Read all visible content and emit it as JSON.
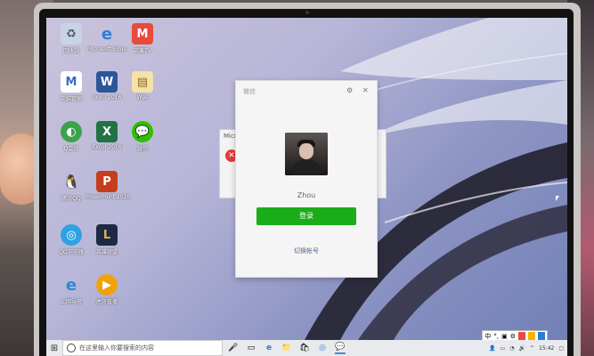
{
  "desktop": {
    "icons": [
      {
        "label": "回收站",
        "icon": "recycle-bin-icon",
        "color": "#c7d4e6"
      },
      {
        "label": "Microsoft Edge",
        "icon": "edge-icon",
        "color": "#2a7fd4"
      },
      {
        "label": "芒果TV",
        "icon": "mango-tv-icon",
        "color": "#e84a3b"
      },
      {
        "label": "电脑管家",
        "icon": "pc-manager-icon",
        "color": "#3b6bc4"
      },
      {
        "label": "Word 2016",
        "icon": "word-icon",
        "color": "#2b579a"
      },
      {
        "label": "Wps",
        "icon": "wps-icon",
        "color": "#d9a441"
      },
      {
        "label": "Q会员",
        "icon": "green-app-icon",
        "color": "#3aa34c"
      },
      {
        "label": "Excel 2016",
        "icon": "excel-icon",
        "color": "#217346"
      },
      {
        "label": "微信",
        "icon": "wechat-icon",
        "color": "#2dc100"
      },
      {
        "label": "腾讯QQ",
        "icon": "qq-icon",
        "color": "#1b1b1b"
      },
      {
        "label": "PowerPoint 2016",
        "icon": "powerpoint-icon",
        "color": "#c43e1c"
      },
      {
        "label": "QQ浏览器",
        "icon": "qq-browser-icon",
        "color": "#2da3e4"
      },
      {
        "label": "英雄联盟",
        "icon": "lol-icon",
        "color": "#1e2a44"
      },
      {
        "label": "上网导航",
        "icon": "ie-icon",
        "color": "#2a8ad6"
      },
      {
        "label": "虎牙直播",
        "icon": "huya-icon",
        "color": "#f0a20a"
      }
    ]
  },
  "background_window": {
    "title": "Micr"
  },
  "wechat_login": {
    "title": "微信",
    "settings_icon": "gear-icon",
    "close_icon": "close-icon",
    "username": "Zhou",
    "login_button": "登录",
    "switch_account": "切换帐号"
  },
  "taskbar": {
    "search_placeholder": "在这里输入你要搜索的内容",
    "time": "15:42",
    "ime_label": "中",
    "ime_punct": "°,"
  }
}
